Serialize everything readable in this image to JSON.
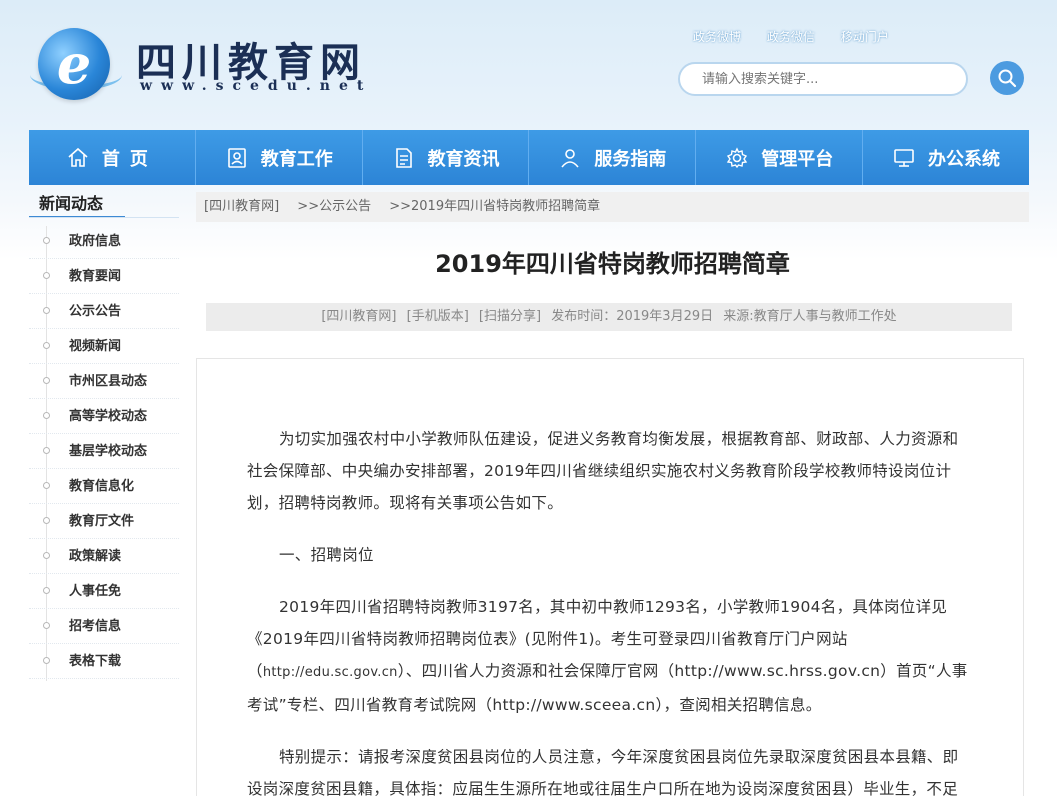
{
  "header": {
    "site_title": "四川教育网",
    "site_url": "www.scedu.net",
    "logo_letter": "e",
    "top_links": [
      "政务微博",
      "政务微信",
      "移动门户"
    ],
    "search_placeholder": "请输入搜索关键字..."
  },
  "nav": {
    "items": [
      {
        "label": "首页",
        "icon": "home-icon"
      },
      {
        "label": "教育工作",
        "icon": "id-card-icon"
      },
      {
        "label": "教育资讯",
        "icon": "document-icon"
      },
      {
        "label": "服务指南",
        "icon": "user-icon"
      },
      {
        "label": "管理平台",
        "icon": "gear-icon"
      },
      {
        "label": "办公系统",
        "icon": "monitor-icon"
      }
    ]
  },
  "sidebar": {
    "title": "新闻动态",
    "items": [
      {
        "label": "政府信息"
      },
      {
        "label": "教育要闻"
      },
      {
        "label": "公示公告"
      },
      {
        "label": "视频新闻"
      },
      {
        "label": "市州区县动态"
      },
      {
        "label": "高等学校动态"
      },
      {
        "label": "基层学校动态"
      },
      {
        "label": "教育信息化"
      },
      {
        "label": "教育厅文件"
      },
      {
        "label": "政策解读"
      },
      {
        "label": "人事任免"
      },
      {
        "label": "招考信息"
      },
      {
        "label": "表格下载"
      }
    ]
  },
  "breadcrumb": [
    "[四川教育网]",
    ">>公示公告",
    ">>2019年四川省特岗教师招聘简章"
  ],
  "article": {
    "title": "2019年四川省特岗教师招聘简章",
    "meta": [
      "[四川教育网]",
      "[手机版本]",
      "[扫描分享]",
      "发布时间：2019年3月29日",
      "来源:教育厅人事与教师工作处"
    ],
    "p1": "为切实加强农村中小学教师队伍建设，促进义务教育均衡发展，根据教育部、财政部、人力资源和社会保障部、中央编办安排部署，2019年四川省继续组织实施农村义务教育阶段学校教师特设岗位计划，招聘特岗教师。现将有关事项公告如下。",
    "p2": "一、招聘岗位",
    "p3a": "2019年四川省招聘特岗教师3197名，其中初中教师1293名，小学教师1904名，具体岗位详见《2019年四川省特岗教师招聘岗位表》(见附件1)。考生可登录四川省教育厅门户网站（",
    "p3_link": "http://edu.sc.gov.cn",
    "p3b": "）、四川省人力资源和社会保障厅官网（http://www.sc.hrss.gov.cn）首页“人事考试”专栏、四川省教育考试院网（http://www.sceea.cn），查阅相关招聘信息。",
    "p4": "特别提示：请报考深度贫困县岗位的人员注意，今年深度贫困县岗位先录取深度贫困县本县籍、即设岗深度贫困县籍，具体指：应届生生源所在地或往届生户口所在地为设岗深度贫困县）毕业生，不足"
  }
}
